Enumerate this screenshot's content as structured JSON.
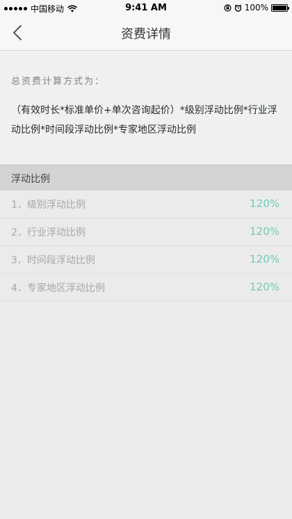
{
  "status_bar": {
    "carrier": "中国移动",
    "time": "9:41 AM",
    "battery": "100%",
    "icons": [
      "signal-dots-icon",
      "wifi-icon",
      "rotation-lock-icon",
      "alarm-icon",
      "battery-icon"
    ]
  },
  "nav": {
    "title": "资费详情",
    "back_icon": "chevron-left-icon"
  },
  "info": {
    "formula_label": "总资费计算方式为：",
    "formula_text": "（有效时长*标准单价+单次咨询起价）*级别浮动比例*行业浮动比例*时间段浮动比例*专家地区浮动比例"
  },
  "section": {
    "title": "浮动比例"
  },
  "items": [
    {
      "label": "1．级别浮动比例",
      "value": "120%"
    },
    {
      "label": "2．行业浮动比例",
      "value": "120%"
    },
    {
      "label": "3．时间段浮动比例",
      "value": "120%"
    },
    {
      "label": "4．专家地区浮动比例",
      "value": "120%"
    }
  ],
  "colors": {
    "accent": "#6fcbb5",
    "background": "#ebebeb",
    "section_header": "#d3d3d3"
  }
}
